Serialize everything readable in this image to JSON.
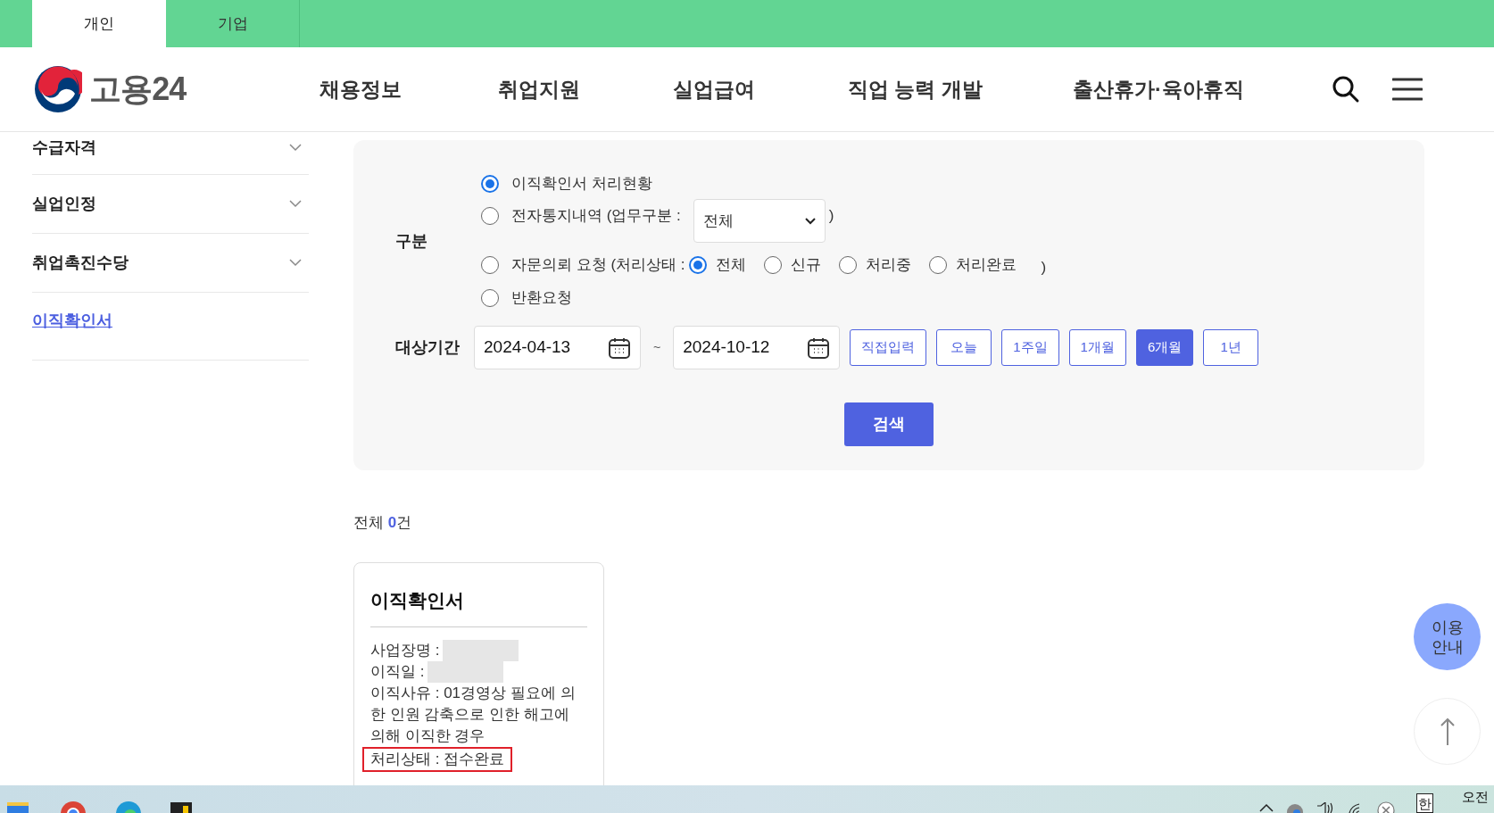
{
  "top_tabs": [
    {
      "label": "개인",
      "selected": true
    },
    {
      "label": "기업",
      "selected": false
    }
  ],
  "logo": {
    "text": "고용24"
  },
  "nav": [
    "채용정보",
    "취업지원",
    "실업급여",
    "직업 능력 개발",
    "출산휴가·육아휴직"
  ],
  "sidebar": {
    "items": [
      {
        "label": "수급자격",
        "kind": "group",
        "selected": false
      },
      {
        "label": "실업인정",
        "kind": "group",
        "selected": false
      },
      {
        "label": "취업촉진수당",
        "kind": "group",
        "selected": false
      },
      {
        "label": "이직확인서",
        "kind": "link",
        "selected": true
      }
    ]
  },
  "form": {
    "category_label": "구분",
    "options": [
      {
        "label": "이직확인서 처리현황",
        "kind": "plain",
        "selected": true
      },
      {
        "label": "전자통지내역 (업무구분 :",
        "kind": "select",
        "selected": false,
        "select_value": "전체",
        "suffix": ")"
      },
      {
        "label": "자문의뢰 요청 (처리상태 :",
        "kind": "status",
        "selected": false,
        "suffix": ")",
        "sub_options": [
          {
            "label": "전체",
            "selected": true
          },
          {
            "label": "신규",
            "selected": false
          },
          {
            "label": "처리중",
            "selected": false
          },
          {
            "label": "처리완료",
            "selected": false
          }
        ]
      },
      {
        "label": "반환요청",
        "kind": "plain",
        "selected": false
      }
    ],
    "period_label": "대상기간",
    "date_from": "2024-04-13",
    "separator": "~",
    "date_to": "2024-10-12",
    "period_buttons": [
      {
        "label": "직접입력",
        "selected": false
      },
      {
        "label": "오늘",
        "selected": false
      },
      {
        "label": "1주일",
        "selected": false
      },
      {
        "label": "1개월",
        "selected": false
      },
      {
        "label": "6개월",
        "selected": true
      },
      {
        "label": "1년",
        "selected": false
      }
    ],
    "search_button": "검색"
  },
  "results": {
    "total_prefix": "전체",
    "count": "0",
    "total_suffix": "건"
  },
  "card": {
    "title": "이직확인서",
    "lines": [
      {
        "text": "사업장명 :",
        "redacted": true,
        "highlighted": false
      },
      {
        "text": "이직일 :",
        "redacted": true,
        "highlighted": false
      },
      {
        "text": "이직사유 : 01경영상 필요에 의한 인원 감축으로 인한 해고에 의해 이직한 경우",
        "redacted": false,
        "highlighted": false
      },
      {
        "text": "처리상태 : 접수완료",
        "redacted": false,
        "highlighted": true
      }
    ]
  },
  "guide_button": "이용 안내",
  "taskbar": {
    "ime": "한",
    "clock": "오전"
  }
}
